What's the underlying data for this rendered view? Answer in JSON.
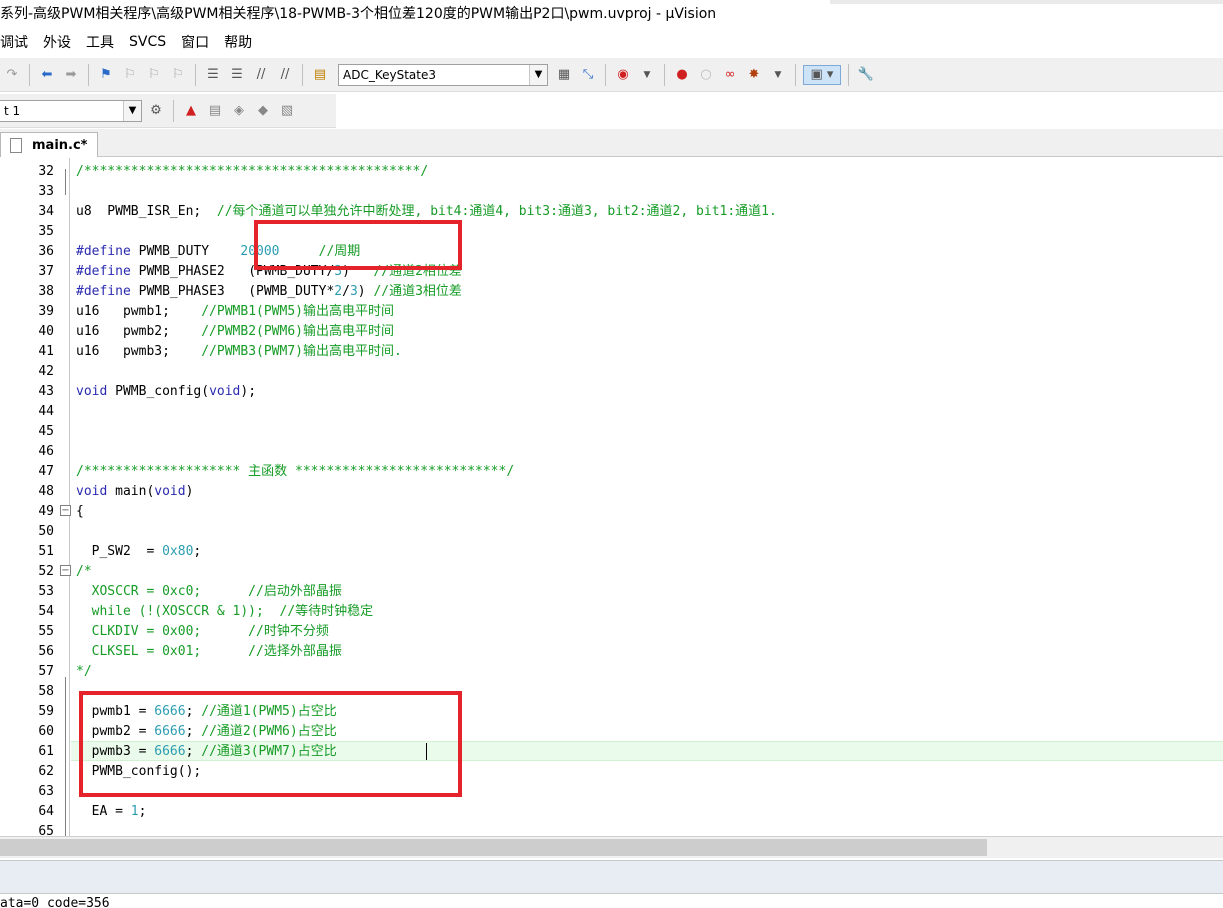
{
  "window": {
    "title": "系列-高级PWM相关程序\\高级PWM相关程序\\18-PWMB-3个相位差120度的PWM输出P2口\\pwm.uvproj - µVision"
  },
  "menu": {
    "items": [
      "调试",
      "外设",
      "工具",
      "SVCS",
      "窗口",
      "帮助"
    ]
  },
  "toolbar1": {
    "target_combo": "ADC_KeyState3"
  },
  "toolbar2": {
    "target_combo": "t 1"
  },
  "tab": {
    "label": "main.c*"
  },
  "code": [
    {
      "ln": "32",
      "text": "/*******************************************/"
    },
    {
      "ln": "33",
      "text": ""
    },
    {
      "ln": "34",
      "text": "u8  PWMB_ISR_En;  //每个通道可以单独允许中断处理, bit4:通道4, bit3:通道3, bit2:通道2, bit1:通道1."
    },
    {
      "ln": "35",
      "text": ""
    },
    {
      "ln": "36",
      "text": "#define PWMB_DUTY    20000     //周期"
    },
    {
      "ln": "37",
      "text": "#define PWMB_PHASE2   (PWMB_DUTY/3)   //通道2相位差"
    },
    {
      "ln": "38",
      "text": "#define PWMB_PHASE3   (PWMB_DUTY*2/3) //通道3相位差"
    },
    {
      "ln": "39",
      "text": "u16   pwmb1;    //PWMB1(PWM5)输出高电平时间"
    },
    {
      "ln": "40",
      "text": "u16   pwmb2;    //PWMB2(PWM6)输出高电平时间"
    },
    {
      "ln": "41",
      "text": "u16   pwmb3;    //PWMB3(PWM7)输出高电平时间."
    },
    {
      "ln": "42",
      "text": ""
    },
    {
      "ln": "43",
      "text": "void PWMB_config(void);"
    },
    {
      "ln": "44",
      "text": ""
    },
    {
      "ln": "45",
      "text": ""
    },
    {
      "ln": "46",
      "text": ""
    },
    {
      "ln": "47",
      "text": "/******************** 主函数 ***************************/"
    },
    {
      "ln": "48",
      "text": "void main(void)"
    },
    {
      "ln": "49",
      "text": "{"
    },
    {
      "ln": "50",
      "text": ""
    },
    {
      "ln": "51",
      "text": "  P_SW2  = 0x80;"
    },
    {
      "ln": "52",
      "text": "/*"
    },
    {
      "ln": "53",
      "text": "  XOSCCR = 0xc0;      //启动外部晶振"
    },
    {
      "ln": "54",
      "text": "  while (!(XOSCCR & 1));  //等待时钟稳定"
    },
    {
      "ln": "55",
      "text": "  CLKDIV = 0x00;      //时钟不分频"
    },
    {
      "ln": "56",
      "text": "  CLKSEL = 0x01;      //选择外部晶振"
    },
    {
      "ln": "57",
      "text": "*/"
    },
    {
      "ln": "58",
      "text": ""
    },
    {
      "ln": "59",
      "text": "  pwmb1 = 6666; //通道1(PWM5)占空比"
    },
    {
      "ln": "60",
      "text": "  pwmb2 = 6666; //通道2(PWM6)占空比"
    },
    {
      "ln": "61",
      "text": "  pwmb3 = 6666; //通道3(PWM7)占空比"
    },
    {
      "ln": "62",
      "text": "  PWMB_config();"
    },
    {
      "ln": "63",
      "text": ""
    },
    {
      "ln": "64",
      "text": "  EA = 1;"
    },
    {
      "ln": "65",
      "text": ""
    }
  ],
  "status": {
    "text": "ata=0 code=356"
  },
  "colors": {
    "keyword": "#2a2ab0",
    "comment": "#179c27",
    "number": "#2a9db0",
    "highlight_box": "#e4242a",
    "current_line": "#ebfbeb"
  }
}
